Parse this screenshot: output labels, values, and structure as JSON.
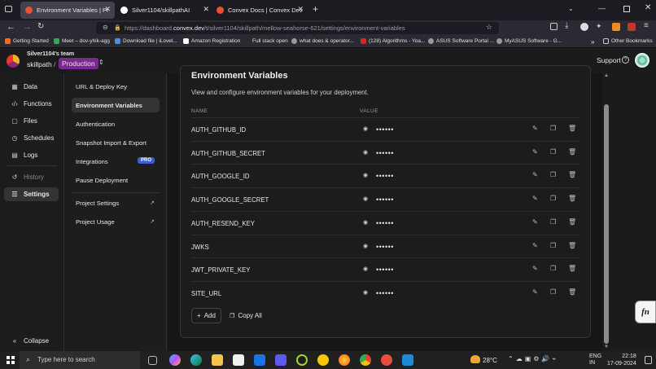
{
  "browser": {
    "tabs": [
      {
        "title": "Environment Variables | Prod | s",
        "active": true,
        "color": "#e8522e"
      },
      {
        "title": "Silver1104/skillpathAI",
        "active": false,
        "color": "#ffffff"
      },
      {
        "title": "Convex Docs | Convex Develop",
        "active": false,
        "color": "#e8522e"
      }
    ],
    "url_prefix": "https://dashboard.",
    "url_domain": "convex.dev",
    "url_path": "/t/silver1104/skillpath/mellow-seahorse-621/settings/environment-variables",
    "bookmarks": [
      "Getting Started",
      "Meet – dov-yhik-agg",
      "Download file | iLovel...",
      "Amazon Registration",
      "Full stack open",
      "what does & operator...",
      "(128) Algorithms - Yoa...",
      "ASUS Software Portal ...",
      "MyASUS Software - G...",
      "Other Bookmarks"
    ]
  },
  "header": {
    "team": "Silver1104's team",
    "project": "skillpath",
    "separator": "/",
    "deployment": "Production",
    "support": "Support"
  },
  "sidebar": {
    "items": [
      {
        "label": "Data",
        "icon": "table-icon"
      },
      {
        "label": "Functions",
        "icon": "code-icon"
      },
      {
        "label": "Files",
        "icon": "file-icon"
      },
      {
        "label": "Schedules",
        "icon": "clock-icon"
      },
      {
        "label": "Logs",
        "icon": "logs-icon"
      },
      {
        "label": "History",
        "icon": "history-icon"
      },
      {
        "label": "Settings",
        "icon": "settings-icon"
      }
    ],
    "collapse": "Collapse"
  },
  "subnav": {
    "items": [
      "URL & Deploy Key",
      "Environment Variables",
      "Authentication",
      "Snapshot Import & Export",
      "Integrations",
      "Pause Deployment",
      "Project Settings",
      "Project Usage"
    ],
    "pro_badge": "PRO"
  },
  "env": {
    "title": "Environment Variables",
    "description": "View and configure environment variables for your deployment.",
    "col_name": "NAME",
    "col_value": "VALUE",
    "masked": "••••••",
    "rows": [
      "AUTH_GITHUB_ID",
      "AUTH_GITHUB_SECRET",
      "AUTH_GOOGLE_ID",
      "AUTH_GOOGLE_SECRET",
      "AUTH_RESEND_KEY",
      "JWKS",
      "JWT_PRIVATE_KEY",
      "SITE_URL"
    ],
    "add": "Add",
    "copy_all": "Copy All"
  },
  "fn_button": "fn",
  "taskbar": {
    "search_placeholder": "Type here to search",
    "weather": "28°C",
    "lang": "ENG",
    "region": "IN",
    "time": "22:18",
    "date": "17-09-2024"
  }
}
